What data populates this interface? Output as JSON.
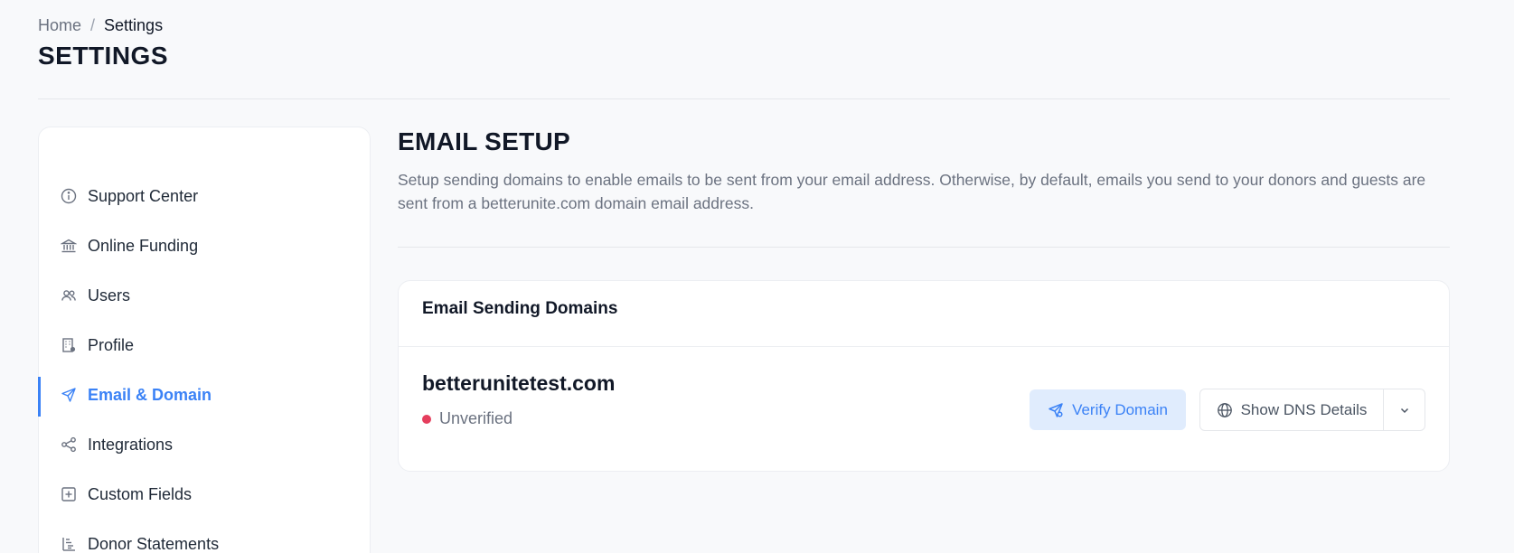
{
  "breadcrumb": {
    "home": "Home",
    "separator": "/",
    "current": "Settings"
  },
  "page": {
    "title": "SETTINGS"
  },
  "sidebar": {
    "items": [
      {
        "label": "Support Center",
        "icon": "info-circle-icon",
        "active": false
      },
      {
        "label": "Online Funding",
        "icon": "bank-icon",
        "active": false
      },
      {
        "label": "Users",
        "icon": "users-icon",
        "active": false
      },
      {
        "label": "Profile",
        "icon": "building-icon",
        "active": false
      },
      {
        "label": "Email & Domain",
        "icon": "send-icon",
        "active": true
      },
      {
        "label": "Integrations",
        "icon": "share-icon",
        "active": false
      },
      {
        "label": "Custom Fields",
        "icon": "plus-square-icon",
        "active": false
      },
      {
        "label": "Donor Statements",
        "icon": "list-tree-icon",
        "active": false
      }
    ]
  },
  "main": {
    "title": "EMAIL SETUP",
    "description": "Setup sending domains to enable emails to be sent from your email address. Otherwise, by default, emails you send to your donors and guests are sent from a betterunite.com domain email address.",
    "card": {
      "title": "Email Sending Domains",
      "domain": "betterunitetest.com",
      "status": "Unverified",
      "verify_label": "Verify Domain",
      "dns_label": "Show DNS Details"
    }
  },
  "colors": {
    "accent": "#3b82f6",
    "status_unverified": "#e53e5d",
    "verify_bg": "#e0ecfd"
  }
}
